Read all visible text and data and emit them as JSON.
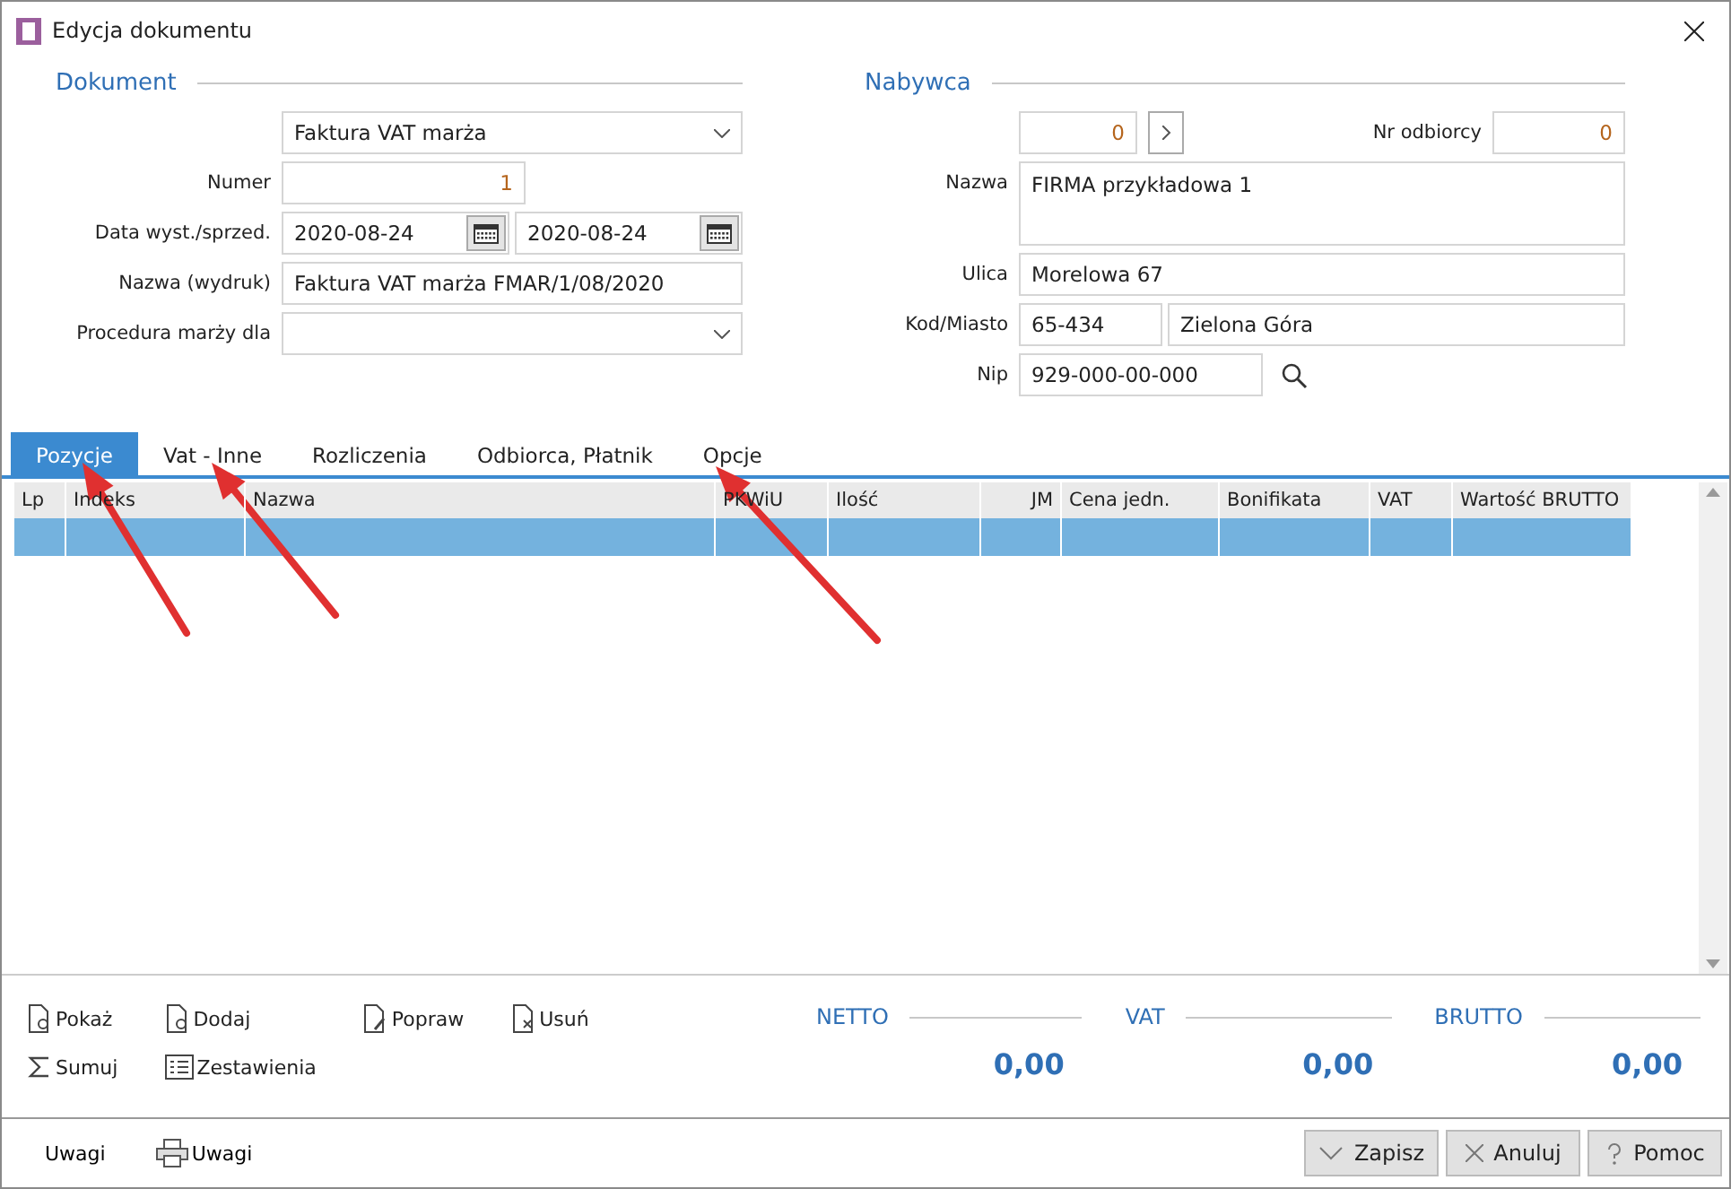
{
  "window": {
    "title": "Edycja dokumentu"
  },
  "dokument": {
    "heading": "Dokument",
    "type_select": "Faktura VAT marża",
    "numer_label": "Numer",
    "numer": "1",
    "date_label": "Data wyst./sprzed.",
    "date_issue": "2020-08-24",
    "date_sale": "2020-08-24",
    "name_label": "Nazwa (wydruk)",
    "name": "Faktura VAT marża FMAR/1/08/2020",
    "procedure_label": "Procedura marży dla"
  },
  "nabywca": {
    "heading": "Nabywca",
    "id": "0",
    "recipient_label": "Nr odbiorcy",
    "recipient": "0",
    "name_label": "Nazwa",
    "name": "FIRMA przykładowa 1",
    "street_label": "Ulica",
    "street": "Morelowa 67",
    "city_label": "Kod/Miasto",
    "postcode": "65-434",
    "city": "Zielona Góra",
    "nip_label": "Nip",
    "nip": "929-000-00-000"
  },
  "tabs": [
    {
      "label": "Pozycje",
      "selected": true
    },
    {
      "label": "Vat - Inne",
      "selected": false
    },
    {
      "label": "Rozliczenia",
      "selected": false
    },
    {
      "label": "Odbiorca, Płatnik",
      "selected": false
    },
    {
      "label": "Opcje",
      "selected": false
    }
  ],
  "table": {
    "columns": [
      "Lp",
      "Indeks",
      "Nazwa",
      "PKWiU",
      "Ilość",
      "JM",
      "Cena jedn.",
      "Bonifikata",
      "VAT",
      "Wartość BRUTTO"
    ],
    "rows": [
      {
        "selected": true
      }
    ]
  },
  "actions": [
    {
      "label": "Pokaż",
      "kind": "show"
    },
    {
      "label": "Dodaj",
      "kind": "add"
    },
    {
      "label": "Popraw",
      "kind": "edit"
    },
    {
      "label": "Usuń",
      "kind": "delete"
    },
    {
      "label": "Sumuj",
      "kind": "sum"
    },
    {
      "label": "Zestawienia",
      "kind": "list"
    }
  ],
  "totals": [
    {
      "label": "NETTO",
      "value": "0,00"
    },
    {
      "label": "VAT",
      "value": "0,00"
    },
    {
      "label": "BRUTTO",
      "value": "0,00"
    }
  ],
  "footer_left": [
    {
      "label": "Uwagi",
      "kind": "plain"
    },
    {
      "label": "Uwagi",
      "kind": "print"
    }
  ],
  "buttons": [
    {
      "label": "Zapisz",
      "kind": "save"
    },
    {
      "label": "Anuluj",
      "kind": "cancel"
    },
    {
      "label": "Pomoc",
      "kind": "help"
    }
  ]
}
